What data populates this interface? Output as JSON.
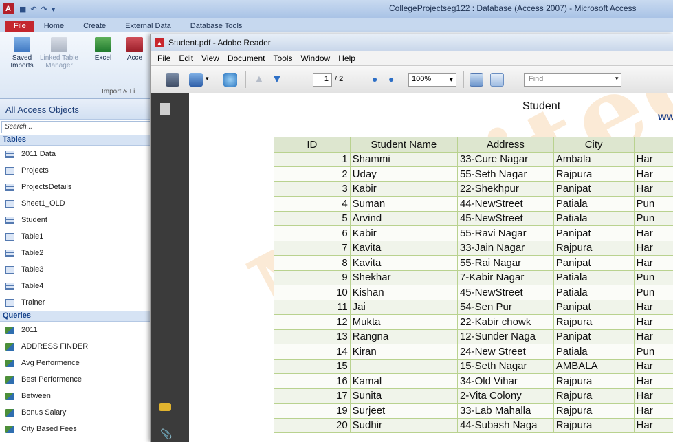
{
  "access": {
    "title": "CollegeProjectseg122 : Database (Access 2007)  -  Microsoft Access",
    "app_icon_letter": "A",
    "tabs": [
      "File",
      "Home",
      "Create",
      "External Data",
      "Database Tools"
    ],
    "ribbon": {
      "buttons": [
        {
          "label": "Saved Imports",
          "icon": "saved-imports-icon"
        },
        {
          "label": "Linked Table Manager",
          "icon": "linked-table-icon"
        },
        {
          "label": "Excel",
          "icon": "excel-icon"
        },
        {
          "label": "Acce",
          "icon": "access-icon"
        }
      ],
      "group_label": "Import & Li"
    },
    "nav": {
      "header": "All Access Objects",
      "search_placeholder": "Search...",
      "sections": [
        {
          "title": "Tables",
          "items": [
            "2011 Data",
            "Projects",
            "ProjectsDetails",
            "Sheet1_OLD",
            "Student",
            "Table1",
            "Table2",
            "Table3",
            "Table4",
            "Trainer"
          ]
        },
        {
          "title": "Queries",
          "items": [
            "2011",
            "ADDRESS FINDER",
            "Avg Performence",
            "Best Performence",
            "Between",
            "Bonus Salary",
            "City Based Fees"
          ]
        }
      ]
    }
  },
  "reader": {
    "title": "Student.pdf - Adobe Reader",
    "menu": [
      "File",
      "Edit",
      "View",
      "Document",
      "Tools",
      "Window",
      "Help"
    ],
    "page_current": "1",
    "page_total": "/ 2",
    "zoom": "100%",
    "find_placeholder": "Find",
    "doc_title": "Student",
    "doc_corner_text": "ww",
    "watermark": "Mobited",
    "table": {
      "headers": [
        "ID",
        "Student Name",
        "Address",
        "City",
        ""
      ],
      "rows": [
        [
          "1",
          "Shammi",
          "33-Cure Nagar",
          "Ambala",
          "Har"
        ],
        [
          "2",
          "Uday",
          "55-Seth Nagar",
          "Rajpura",
          "Har"
        ],
        [
          "3",
          "Kabir",
          "22-Shekhpur",
          "Panipat",
          "Har"
        ],
        [
          "4",
          "Suman",
          "44-NewStreet",
          "Patiala",
          "Pun"
        ],
        [
          "5",
          "Arvind",
          "45-NewStreet",
          "Patiala",
          "Pun"
        ],
        [
          "6",
          "Kabir",
          "55-Ravi Nagar",
          "Panipat",
          "Har"
        ],
        [
          "7",
          "Kavita",
          "33-Jain Nagar",
          "Rajpura",
          "Har"
        ],
        [
          "8",
          "Kavita",
          "55-Rai Nagar",
          "Panipat",
          "Har"
        ],
        [
          "9",
          "Shekhar",
          "7-Kabir Nagar",
          "Patiala",
          "Pun"
        ],
        [
          "10",
          "Kishan",
          "45-NewStreet",
          "Patiala",
          "Pun"
        ],
        [
          "11",
          "Jai",
          "54-Sen Pur",
          "Panipat",
          "Har"
        ],
        [
          "12",
          "Mukta",
          "22-Kabir chowk",
          "Rajpura",
          "Har"
        ],
        [
          "13",
          "Rangna",
          "12-Sunder Naga",
          "Panipat",
          "Har"
        ],
        [
          "14",
          "Kiran",
          "24-New Street",
          "Patiala",
          "Pun"
        ],
        [
          "15",
          "",
          "15-Seth Nagar",
          "AMBALA",
          "Har"
        ],
        [
          "16",
          "Kamal",
          "34-Old Vihar",
          "Rajpura",
          "Har"
        ],
        [
          "17",
          "Sunita",
          "2-Vita Colony",
          "Rajpura",
          "Har"
        ],
        [
          "19",
          "Surjeet",
          "33-Lab Mahalla",
          "Rajpura",
          "Har"
        ],
        [
          "20",
          "Sudhir",
          "44-Subash Naga",
          "Rajpura",
          "Har"
        ]
      ]
    }
  }
}
